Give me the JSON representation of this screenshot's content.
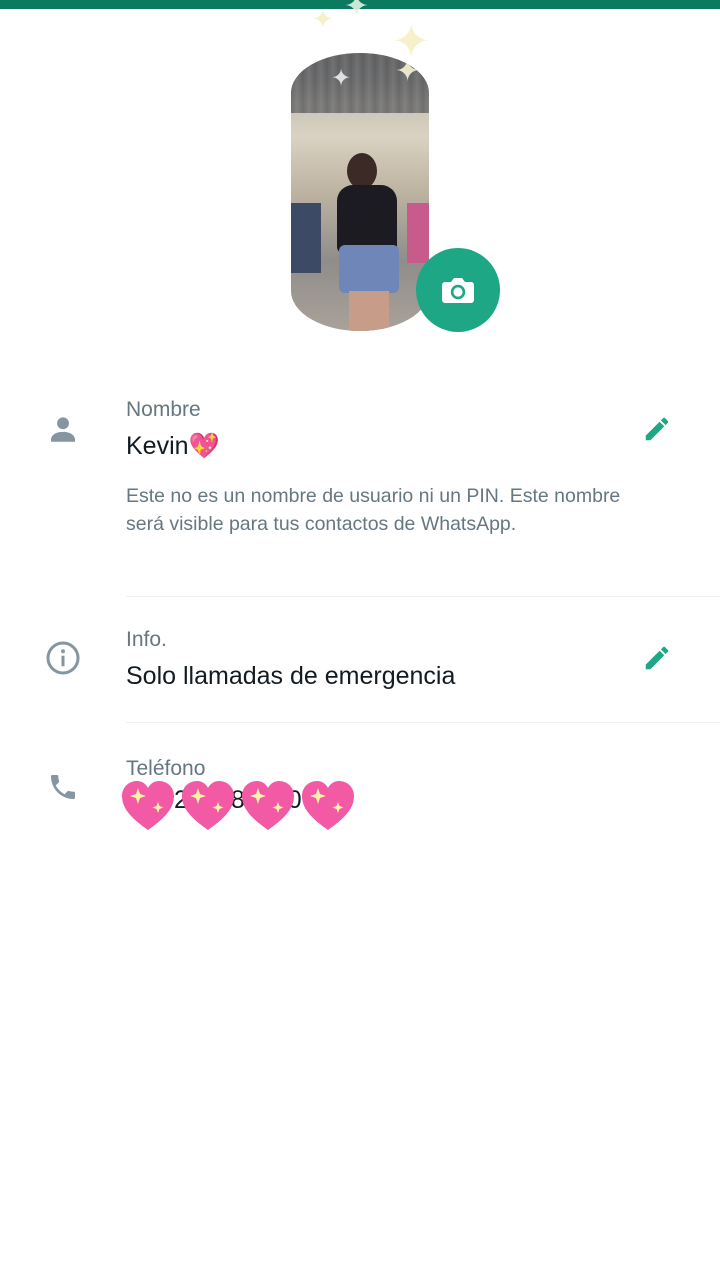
{
  "colors": {
    "accent": "#1ea785",
    "top_bar": "#0b7a5e",
    "label": "#667781",
    "text": "#111b21"
  },
  "profile_photo": {
    "icon": "camera-icon"
  },
  "name_row": {
    "icon": "person-icon",
    "label": "Nombre",
    "value": "Kevin💖",
    "help": "Este no es un nombre de usuario ni un PIN. Este nombre será visible para tus contactos de WhatsApp.",
    "edit_icon": "pencil-icon"
  },
  "info_row": {
    "icon": "info-icon",
    "label": "Info.",
    "value": "Solo llamadas de emergencia",
    "edit_icon": "pencil-icon"
  },
  "phone_row": {
    "icon": "phone-icon",
    "label": "Teléfono",
    "visible_digits": "2 8 0",
    "overlay": "💖💖💖💖"
  }
}
